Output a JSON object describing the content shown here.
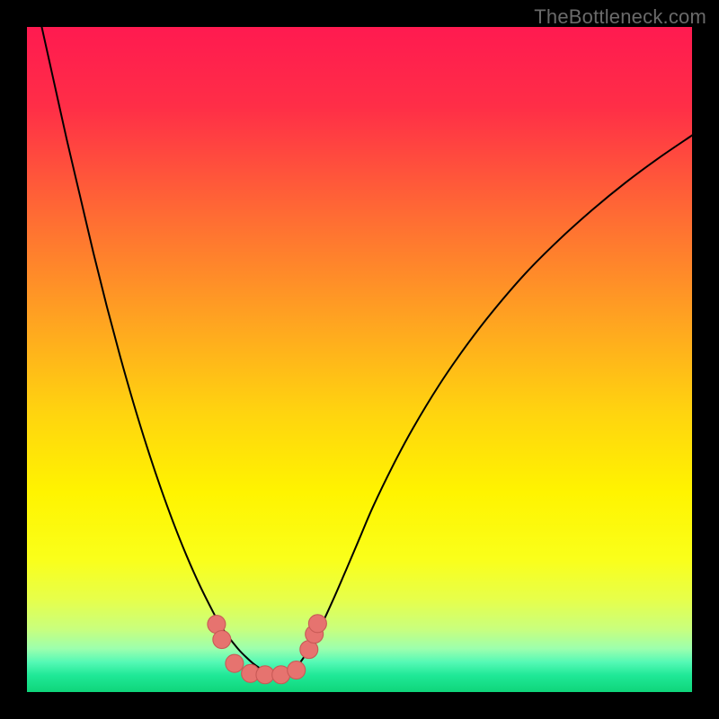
{
  "watermark": "TheBottleneck.com",
  "colors": {
    "frame": "#000000",
    "watermark": "#6a6a6a",
    "gradient_stops": [
      {
        "offset": 0.0,
        "color": "#ff1a50"
      },
      {
        "offset": 0.12,
        "color": "#ff2e47"
      },
      {
        "offset": 0.28,
        "color": "#ff6a34"
      },
      {
        "offset": 0.44,
        "color": "#ffa321"
      },
      {
        "offset": 0.58,
        "color": "#ffd40f"
      },
      {
        "offset": 0.7,
        "color": "#fff400"
      },
      {
        "offset": 0.8,
        "color": "#faff1a"
      },
      {
        "offset": 0.86,
        "color": "#e7ff4a"
      },
      {
        "offset": 0.905,
        "color": "#c9ff7d"
      },
      {
        "offset": 0.935,
        "color": "#9cffae"
      },
      {
        "offset": 0.955,
        "color": "#55f9b5"
      },
      {
        "offset": 0.975,
        "color": "#1fe897"
      },
      {
        "offset": 1.0,
        "color": "#0fd57a"
      }
    ],
    "curve_stroke": "#000000",
    "marker_fill": "#e6736f",
    "marker_stroke": "#c85a56"
  },
  "chart_data": {
    "type": "line",
    "title": "",
    "xlabel": "",
    "ylabel": "",
    "xlim": [
      0,
      100
    ],
    "ylim": [
      0,
      100
    ],
    "x": [
      0,
      2,
      4,
      6,
      8,
      10,
      12,
      14,
      16,
      18,
      20,
      22,
      24,
      26,
      28,
      29,
      30,
      31,
      32,
      33,
      34,
      35,
      36,
      37,
      38,
      40,
      42,
      44,
      46,
      48,
      50,
      52,
      55,
      58,
      62,
      66,
      70,
      75,
      80,
      85,
      90,
      95,
      100
    ],
    "series": [
      {
        "name": "bottleneck-curve",
        "values": [
          110,
          101,
          92,
          83,
          74.5,
          66,
          58,
          50.5,
          43.5,
          37,
          31,
          25.5,
          20.5,
          16,
          12,
          10.2,
          8.7,
          7.4,
          6.2,
          5.2,
          4.3,
          3.6,
          3.1,
          2.7,
          2.5,
          3.2,
          5.8,
          9.5,
          13.8,
          18.4,
          23.1,
          27.8,
          34.0,
          39.6,
          46.2,
          52.0,
          57.2,
          63.0,
          68.0,
          72.5,
          76.6,
          80.3,
          83.7
        ]
      }
    ],
    "markers": {
      "name": "bottleneck-zone-markers",
      "points": [
        {
          "x": 28.5,
          "y": 10.2
        },
        {
          "x": 29.3,
          "y": 7.9
        },
        {
          "x": 31.2,
          "y": 4.3
        },
        {
          "x": 33.6,
          "y": 2.8
        },
        {
          "x": 35.8,
          "y": 2.6
        },
        {
          "x": 38.2,
          "y": 2.6
        },
        {
          "x": 40.5,
          "y": 3.3
        },
        {
          "x": 42.4,
          "y": 6.4
        },
        {
          "x": 43.2,
          "y": 8.7
        },
        {
          "x": 43.7,
          "y": 10.3
        }
      ],
      "radius": 1.35
    }
  }
}
